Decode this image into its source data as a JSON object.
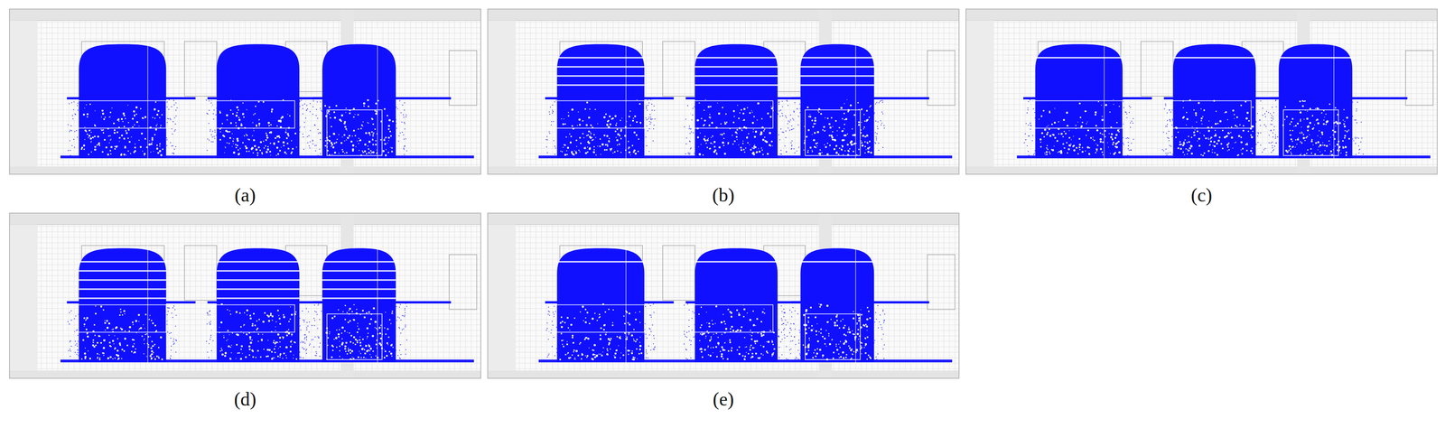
{
  "figure": {
    "panels": [
      {
        "label": "(a)",
        "stripes": 0
      },
      {
        "label": "(b)",
        "stripes": 4
      },
      {
        "label": "(c)",
        "stripes": 1
      },
      {
        "label": "(d)",
        "stripes": 5
      },
      {
        "label": "(e)",
        "stripes": 1
      }
    ]
  }
}
